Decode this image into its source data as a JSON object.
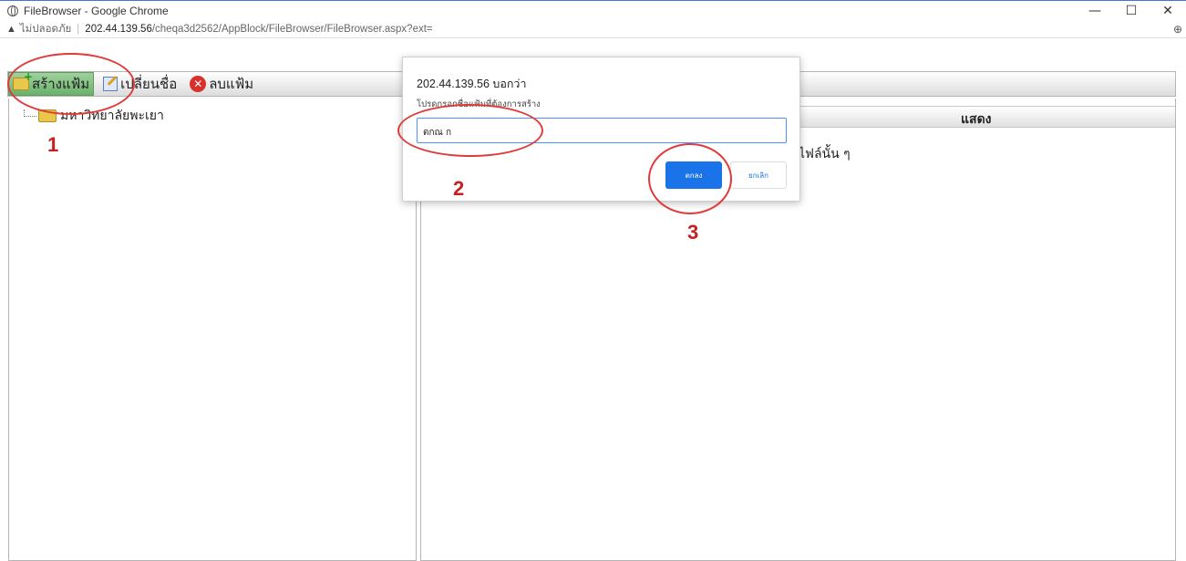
{
  "window": {
    "title": "FileBrowser - Google Chrome",
    "controls": {
      "minimize": "—",
      "maximize": "☐",
      "close": "✕"
    }
  },
  "addressbar": {
    "security_label": "ไม่ปลอดภัย",
    "host": "202.44.139.56",
    "path": "/cheqa3d2562/AppBlock/FileBrowser/FileBrowser.aspx?ext=",
    "zoom_icon": "zoom-icon"
  },
  "toolbar": {
    "create_folder": "สร้างแฟ้ม",
    "rename": "เปลี่ยนชื่อ",
    "delete_folder": "ลบแฟ้ม"
  },
  "tree": {
    "root_label": "มหาวิทยาลัยพะเยา"
  },
  "right_panel": {
    "header": "แสดง",
    "body_text": "ไฟล์นั้น ๆ"
  },
  "dialog": {
    "origin": "202.44.139.56 บอกว่า",
    "prompt": "โปรดกรอกชื่อแฟ้มที่ต้องการสร้าง",
    "input_value": "ตกณ ก",
    "ok_label": "ตกลง",
    "cancel_label": "ยกเลิก"
  },
  "annotations": {
    "step1": "1",
    "step2": "2",
    "step3": "3",
    "color": "#c42020"
  }
}
